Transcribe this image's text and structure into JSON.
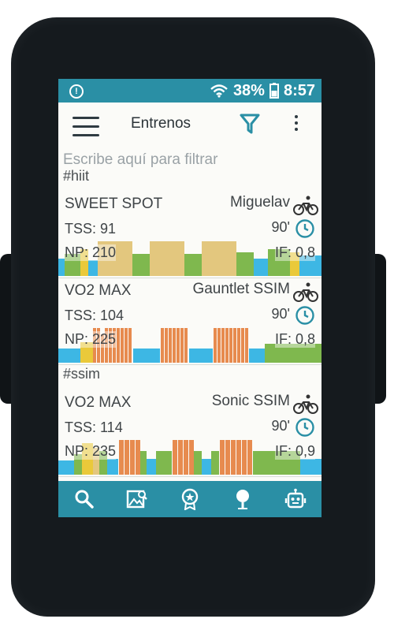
{
  "status": {
    "battery": "38%",
    "time": "8:57"
  },
  "appbar": {
    "title": "Entrenos"
  },
  "filter": {
    "placeholder": "Escribe aquí para filtrar"
  },
  "tags": [
    "#hiit",
    "#ssim"
  ],
  "workouts": [
    {
      "name": "SWEET SPOT",
      "author": "Miguelav",
      "tss": "TSS: 91",
      "duration": "90'",
      "np": "NP: 210",
      "if": "IF: 0,8"
    },
    {
      "name": "VO2 MAX",
      "author": "Gauntlet SSIM",
      "tss": "TSS: 104",
      "duration": "90'",
      "np": "NP: 225",
      "if": "IF: 0,8"
    },
    {
      "name": "VO2 MAX",
      "author": "Sonic SSIM",
      "tss": "TSS: 114",
      "duration": "90'",
      "np": "NP: 235",
      "if": "IF: 0,9"
    }
  ],
  "zone_colors": {
    "z1": "#3db7e4",
    "z2": "#7fb84e",
    "z3": "#e3c77e",
    "z4": "#eac93a",
    "z5": "#e78b4f"
  },
  "icons": {
    "nav": [
      "search-icon",
      "image-search-icon",
      "medal-icon",
      "map-pin-icon",
      "robot-icon"
    ]
  }
}
